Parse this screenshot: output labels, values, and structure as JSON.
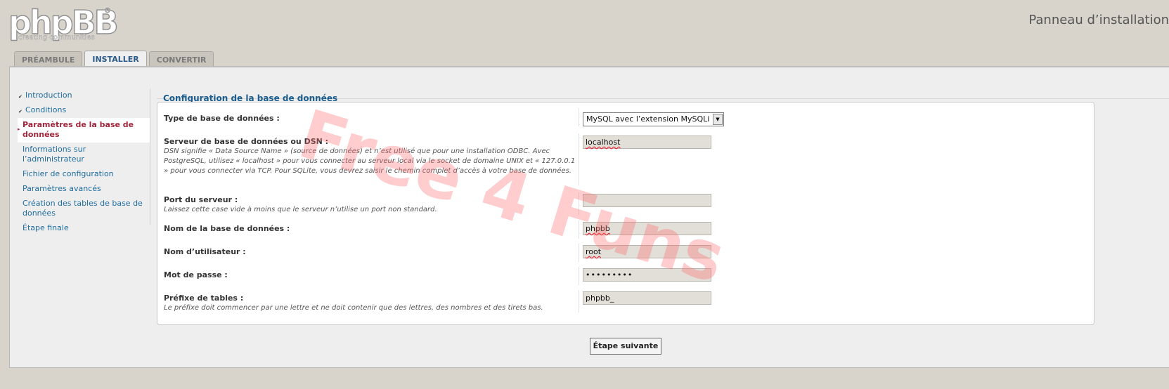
{
  "header": {
    "logo_text": "phpBB",
    "logo_tagline": "creating communities",
    "title": "Panneau d’installation"
  },
  "tabs": [
    {
      "label": "PRÉAMBULE",
      "active": false
    },
    {
      "label": "INSTALLER",
      "active": true
    },
    {
      "label": "CONVERTIR",
      "active": false
    }
  ],
  "sidebar": {
    "items": [
      {
        "label": "Introduction",
        "state": "done"
      },
      {
        "label": "Conditions",
        "state": "done"
      },
      {
        "label": "Paramètres de la base de données",
        "state": "active"
      },
      {
        "label": "Informations sur l’administrateur",
        "state": "todo"
      },
      {
        "label": "Fichier de configuration",
        "state": "todo"
      },
      {
        "label": "Paramètres avancés",
        "state": "todo"
      },
      {
        "label": "Création des tables de base de données",
        "state": "todo"
      },
      {
        "label": "Étape finale",
        "state": "todo"
      }
    ]
  },
  "form": {
    "title": "Configuration de la base de données",
    "fields": {
      "dbms": {
        "label": "Type de base de données :",
        "value": "MySQL avec l’extension MySQLi"
      },
      "dbhost": {
        "label": "Serveur de base de données ou DSN :",
        "description": "DSN signifie « Data Source Name » (source de données) et n’est utilisé que pour une installation ODBC. Avec PostgreSQL, utilisez « localhost » pour vous connecter au serveur local via le socket de domaine UNIX et « 127.0.0.1 » pour vous connecter via TCP. Pour SQLite, vous devrez saisir le chemin complet d’accès à votre base de données.",
        "value": "localhost"
      },
      "dbport": {
        "label": "Port du serveur :",
        "description": "Laissez cette case vide à moins que le serveur n’utilise un port non standard.",
        "value": ""
      },
      "dbname": {
        "label": "Nom de la base de données :",
        "value": "phpbb"
      },
      "dbuser": {
        "label": "Nom d’utilisateur :",
        "value": "root"
      },
      "dbpasswd": {
        "label": "Mot de passe :",
        "value": "•••••••••"
      },
      "table_prefix": {
        "label": "Préfixe de tables :",
        "description": "Le préfixe doit commencer par une lettre et ne doit contenir que des lettres, des nombres et des tirets bas.",
        "value": "phpbb_"
      }
    },
    "submit_label": "Étape suivante"
  },
  "watermark": {
    "text": "Free 4 Funs",
    "color": "#ff6f6f"
  }
}
